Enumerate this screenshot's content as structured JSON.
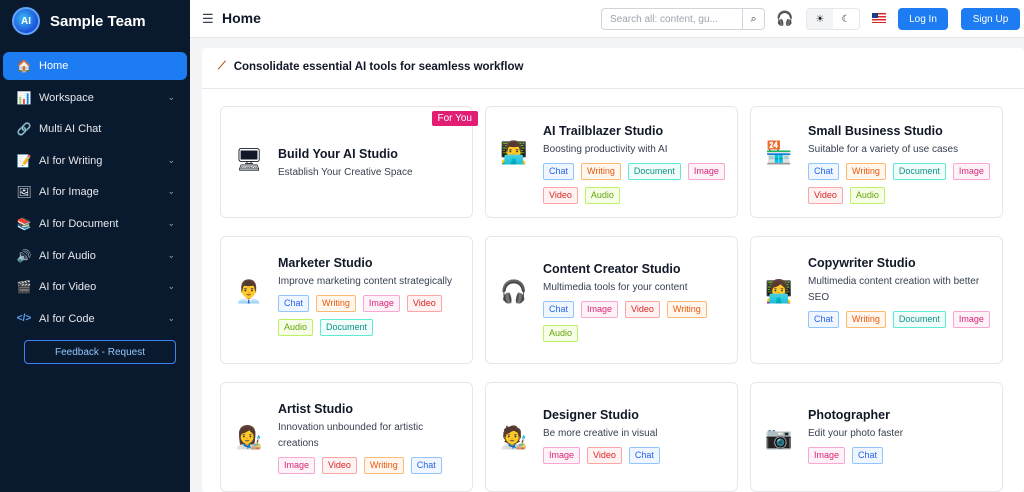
{
  "brand": {
    "name": "Sample Team",
    "logo_text": "AI"
  },
  "sidebar": {
    "items": [
      {
        "label": "Home",
        "icon": "🏠",
        "icon_name": "home-icon",
        "active": true,
        "chevron": false
      },
      {
        "label": "Workspace",
        "icon": "📊",
        "icon_name": "workspace-icon",
        "active": false,
        "chevron": true
      },
      {
        "label": "Multi AI Chat",
        "icon": "🔗",
        "icon_name": "multi-chat-icon",
        "active": false,
        "chevron": false
      },
      {
        "label": "AI for Writing",
        "icon": "📝",
        "icon_name": "writing-icon",
        "active": false,
        "chevron": true
      },
      {
        "label": "AI for Image",
        "icon": "🖼",
        "icon_name": "image-icon",
        "active": false,
        "chevron": true
      },
      {
        "label": "AI for Document",
        "icon": "📚",
        "icon_name": "document-icon",
        "active": false,
        "chevron": true
      },
      {
        "label": "AI for Audio",
        "icon": "🔊",
        "icon_name": "audio-icon",
        "active": false,
        "chevron": true
      },
      {
        "label": "AI for Video",
        "icon": "🎬",
        "icon_name": "video-icon",
        "active": false,
        "chevron": true
      },
      {
        "label": "AI for Code",
        "icon": "</>",
        "icon_name": "code-icon",
        "active": false,
        "chevron": true
      }
    ],
    "feedback_label": "Feedback - Request"
  },
  "header": {
    "title": "Home",
    "search_placeholder": "Search all: content, gu...",
    "login_label": "Log In",
    "signup_label": "Sign Up"
  },
  "main": {
    "banner": "Consolidate essential AI tools for seamless workflow",
    "cards": [
      {
        "title": "Build Your AI Studio",
        "desc": "Establish Your Creative Space",
        "badge": "For You",
        "icon": "🖥",
        "icon_name": "computer-icon",
        "tags": []
      },
      {
        "title": "AI Trailblazer Studio",
        "desc": "Boosting productivity with AI",
        "icon": "👨‍💻",
        "icon_name": "trailblazer-icon",
        "tags": [
          "Chat",
          "Writing",
          "Document",
          "Image",
          "Video",
          "Audio"
        ]
      },
      {
        "title": "Small Business Studio",
        "desc": "Suitable for a variety of use cases",
        "icon": "🏪",
        "icon_name": "store-icon",
        "tags": [
          "Chat",
          "Writing",
          "Document",
          "Image",
          "Video",
          "Audio"
        ]
      },
      {
        "title": "Marketer Studio",
        "desc": "Improve marketing content strategically",
        "icon": "👨‍💼",
        "icon_name": "marketer-icon",
        "tags": [
          "Chat",
          "Writing",
          "Image",
          "Video",
          "Audio",
          "Document"
        ]
      },
      {
        "title": "Content Creator Studio",
        "desc": "Multimedia tools for your content",
        "icon": "🎧",
        "icon_name": "creator-icon",
        "tags": [
          "Chat",
          "Image",
          "Video",
          "Writing",
          "Audio"
        ]
      },
      {
        "title": "Copywriter Studio",
        "desc": "Multimedia content creation with better SEO",
        "icon": "👩‍💻",
        "icon_name": "copywriter-icon",
        "tags": [
          "Chat",
          "Writing",
          "Document",
          "Image"
        ]
      },
      {
        "title": "Artist Studio",
        "desc": "Innovation unbounded for artistic creations",
        "icon": "👩‍🎨",
        "icon_name": "artist-icon",
        "tags": [
          "Image",
          "Video",
          "Writing",
          "Chat"
        ]
      },
      {
        "title": "Designer Studio",
        "desc": "Be more creative in visual",
        "icon": "🧑‍🎨",
        "icon_name": "designer-icon",
        "tags": [
          "Image",
          "Video",
          "Chat"
        ]
      },
      {
        "title": "Photographer",
        "desc": "Edit your photo faster",
        "icon": "📷",
        "icon_name": "photographer-icon",
        "tags": [
          "Image",
          "Chat"
        ]
      }
    ]
  }
}
